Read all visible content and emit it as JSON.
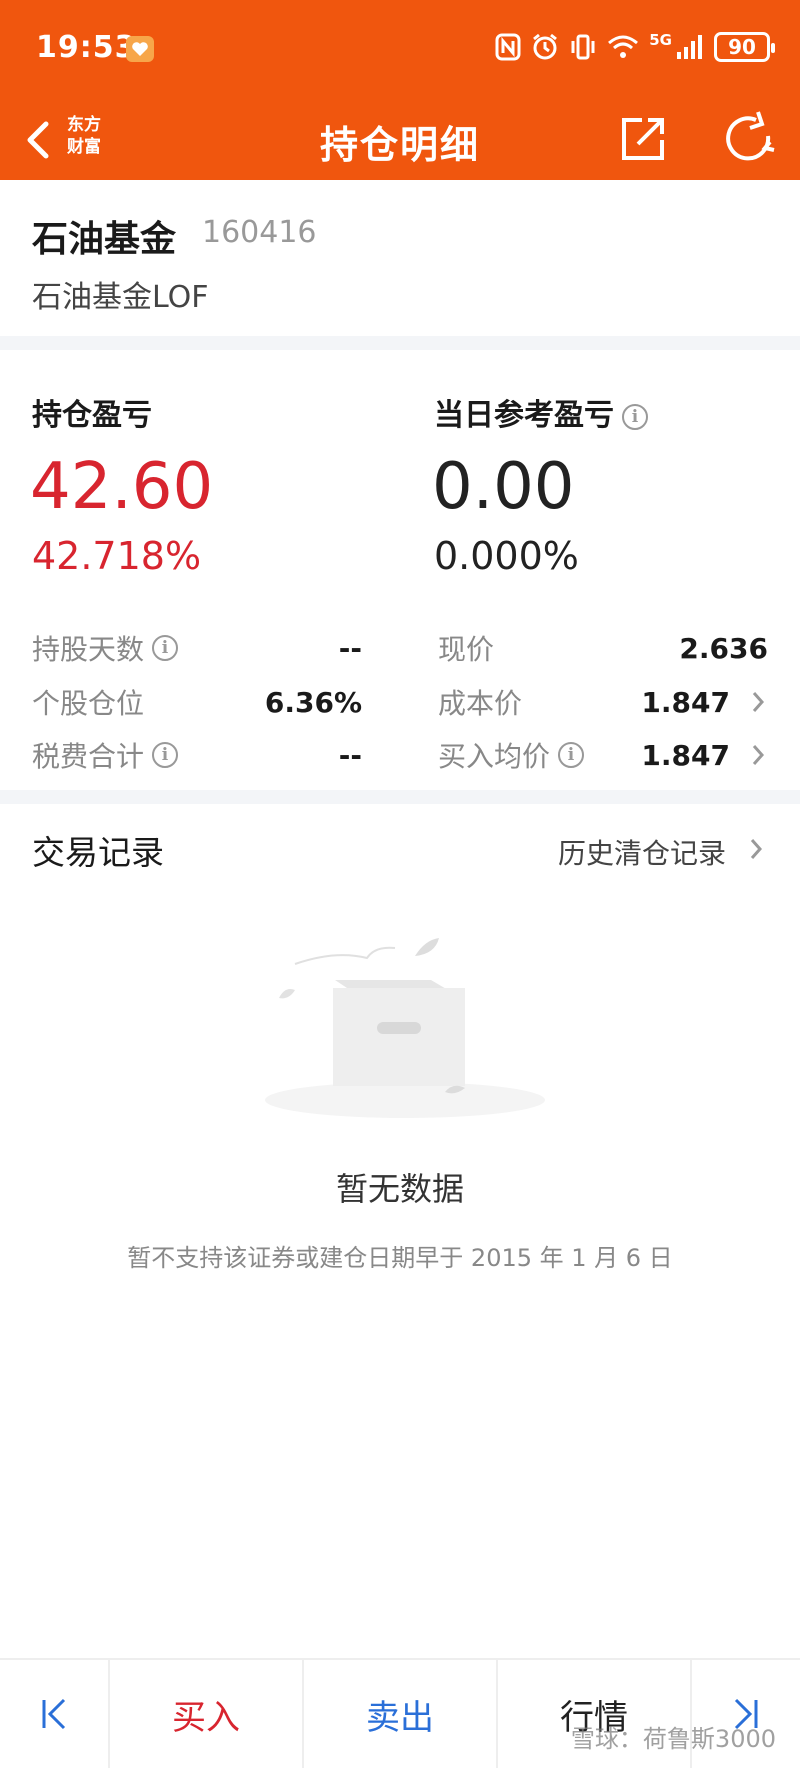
{
  "status_bar": {
    "time": "19:53",
    "network": "5G",
    "battery": "90"
  },
  "nav": {
    "logo_line1": "东方",
    "logo_line2": "财富",
    "title": "持仓明细"
  },
  "stock": {
    "name": "石油基金",
    "code": "160416",
    "full_name": "石油基金LOF"
  },
  "pnl": {
    "holding_label": "持仓盈亏",
    "holding_value": "42.60",
    "holding_pct": "42.718%",
    "daily_label": "当日参考盈亏",
    "daily_value": "0.00",
    "daily_pct": "0.000%"
  },
  "details": {
    "days_label": "持股天数",
    "days_value": "--",
    "price_label": "现价",
    "price_value": "2.636",
    "position_label": "个股仓位",
    "position_value": "6.36%",
    "cost_label": "成本价",
    "cost_value": "1.847",
    "fee_label": "税费合计",
    "fee_value": "--",
    "avg_label": "买入均价",
    "avg_value": "1.847"
  },
  "trade": {
    "title": "交易记录",
    "history_link": "历史清仓记录"
  },
  "empty": {
    "title": "暂无数据",
    "desc": "暂不支持该证券或建仓日期早于 2015 年 1 月 6 日"
  },
  "bottom": {
    "buy": "买入",
    "sell": "卖出",
    "quote": "行情"
  },
  "watermark": "雪球：荷鲁斯3000",
  "colors": {
    "brand": "#f0560e",
    "profit": "#d8252f",
    "sell": "#2a6fd8"
  }
}
